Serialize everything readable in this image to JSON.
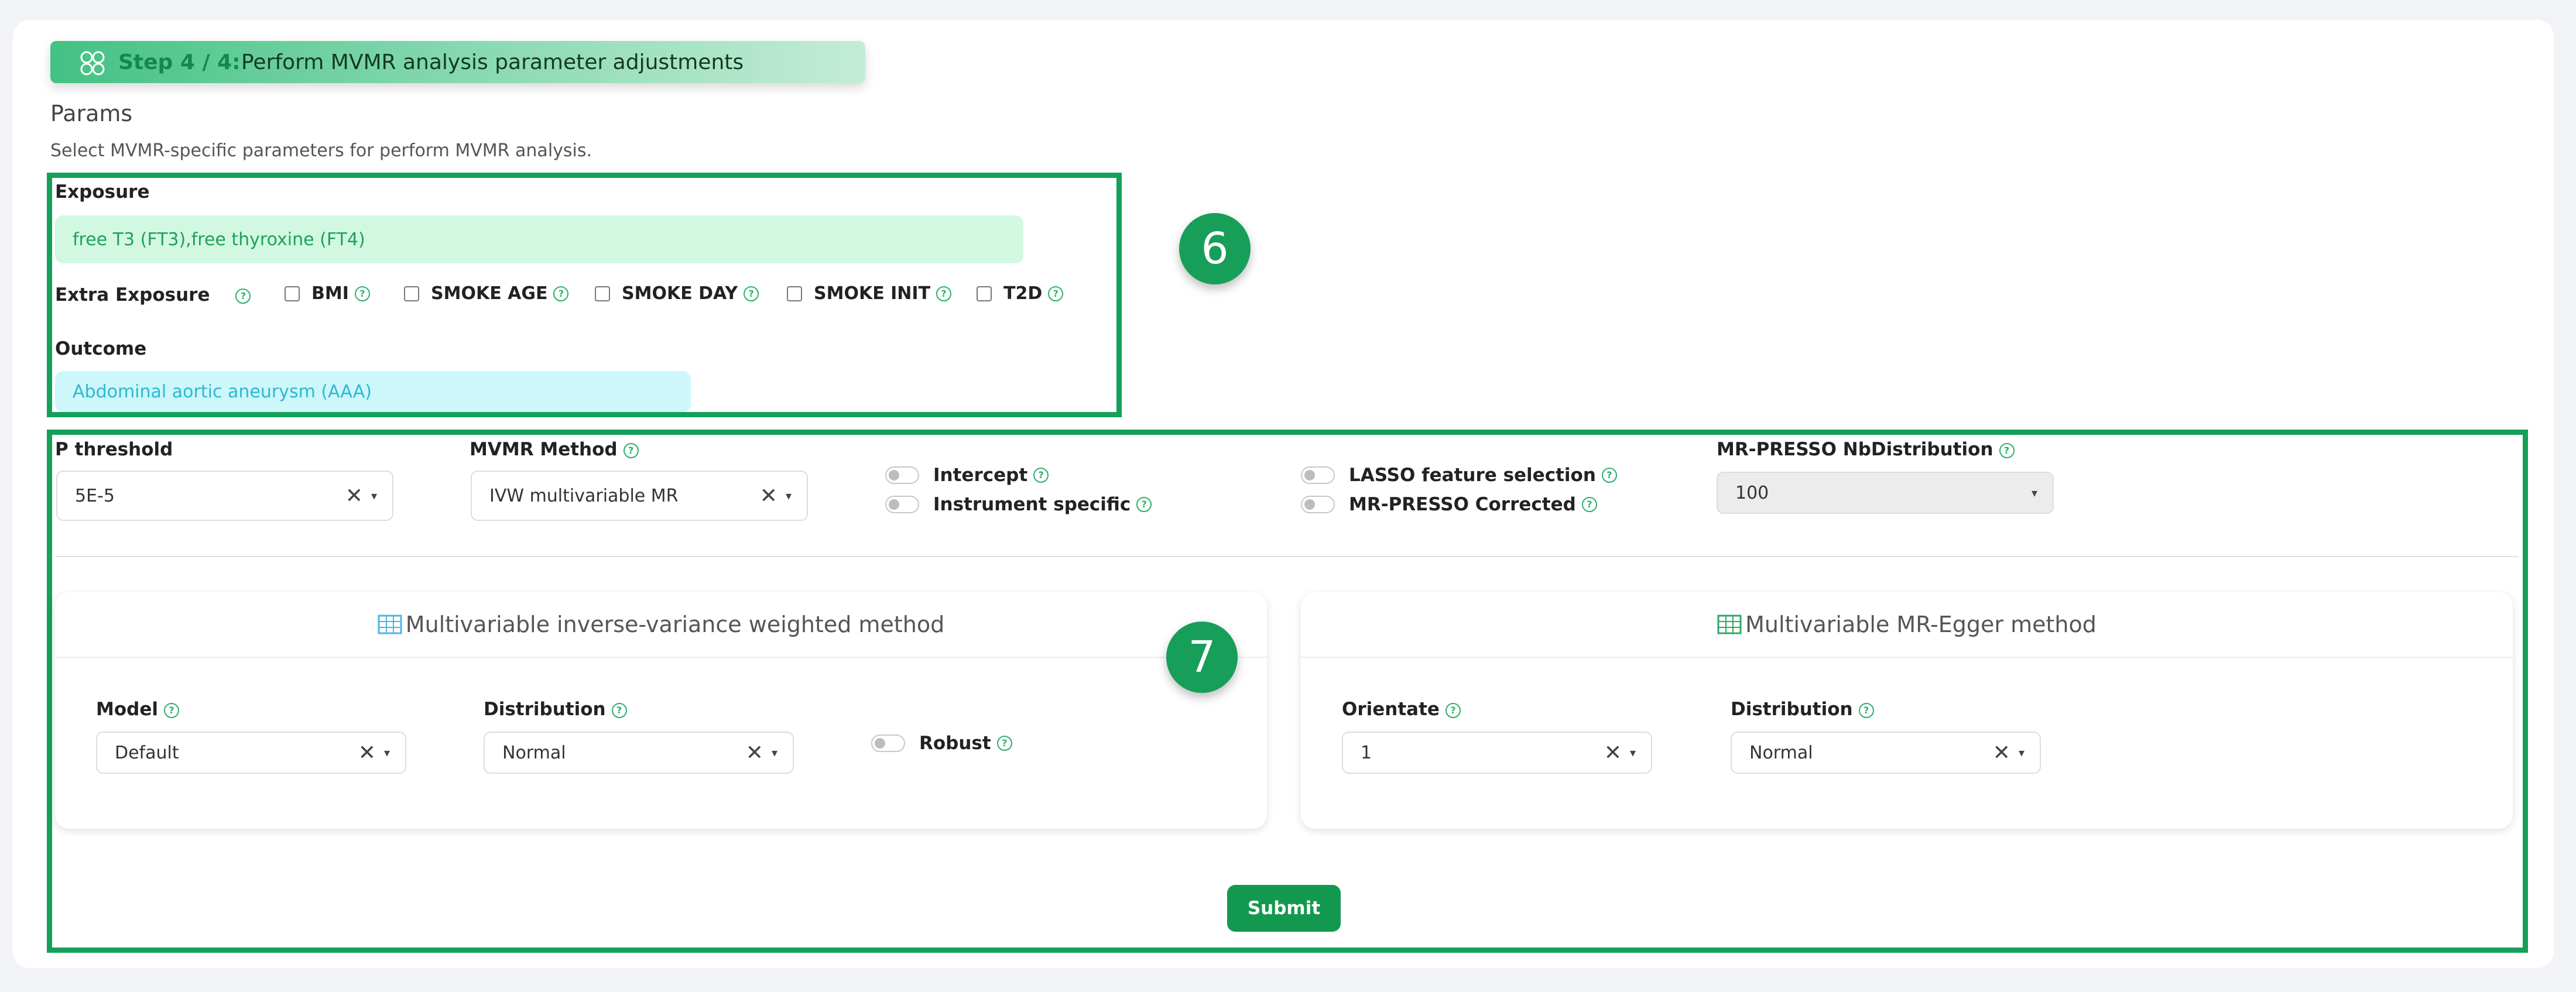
{
  "step": {
    "number": "Step 4 / 4:",
    "title": "Perform MVMR analysis parameter adjustments"
  },
  "params": {
    "title": "Params",
    "subtitle": "Select MVMR-specific parameters for perform MVMR analysis."
  },
  "annotations": {
    "box1": "6",
    "box2": "7"
  },
  "exposure": {
    "label": "Exposure",
    "value": "free T3 (FT3),free thyroxine (FT4)"
  },
  "extra_exposure": {
    "label": "Extra Exposure",
    "options": [
      {
        "label": "BMI",
        "checked": false
      },
      {
        "label": "SMOKE AGE",
        "checked": false
      },
      {
        "label": "SMOKE DAY",
        "checked": false
      },
      {
        "label": "SMOKE INIT",
        "checked": false
      },
      {
        "label": "T2D",
        "checked": false
      }
    ]
  },
  "outcome": {
    "label": "Outcome",
    "value": "Abdominal aortic aneurysm (AAA)"
  },
  "settings": {
    "p_threshold": {
      "label": "P threshold",
      "value": "5E-5"
    },
    "mvmr_method": {
      "label": "MVMR Method",
      "value": "IVW multivariable MR"
    },
    "intercept": {
      "label": "Intercept",
      "on": false
    },
    "instrument_specific": {
      "label": "Instrument specific",
      "on": false
    },
    "lasso": {
      "label": "LASSO feature selection",
      "on": false
    },
    "mrpresso_corrected": {
      "label": "MR-PRESSO Corrected",
      "on": false
    },
    "mrpresso_nb": {
      "label": "MR-PRESSO NbDistribution",
      "value": "100"
    }
  },
  "ivw_panel": {
    "title": "Multivariable inverse-variance weighted method",
    "model": {
      "label": "Model",
      "value": "Default"
    },
    "distribution": {
      "label": "Distribution",
      "value": "Normal"
    },
    "robust": {
      "label": "Robust",
      "on": false
    }
  },
  "egger_panel": {
    "title": "Multivariable MR-Egger method",
    "orientate": {
      "label": "Orientate",
      "value": "1"
    },
    "distribution": {
      "label": "Distribution",
      "value": "Normal"
    }
  },
  "submit_label": "Submit",
  "glyphs": {
    "help": "?",
    "clear": "✕",
    "caret": "▾"
  },
  "colors": {
    "accent": "#15a05a",
    "exposure_bg": "#d3f8e2",
    "outcome_bg": "#cdf7fb"
  }
}
